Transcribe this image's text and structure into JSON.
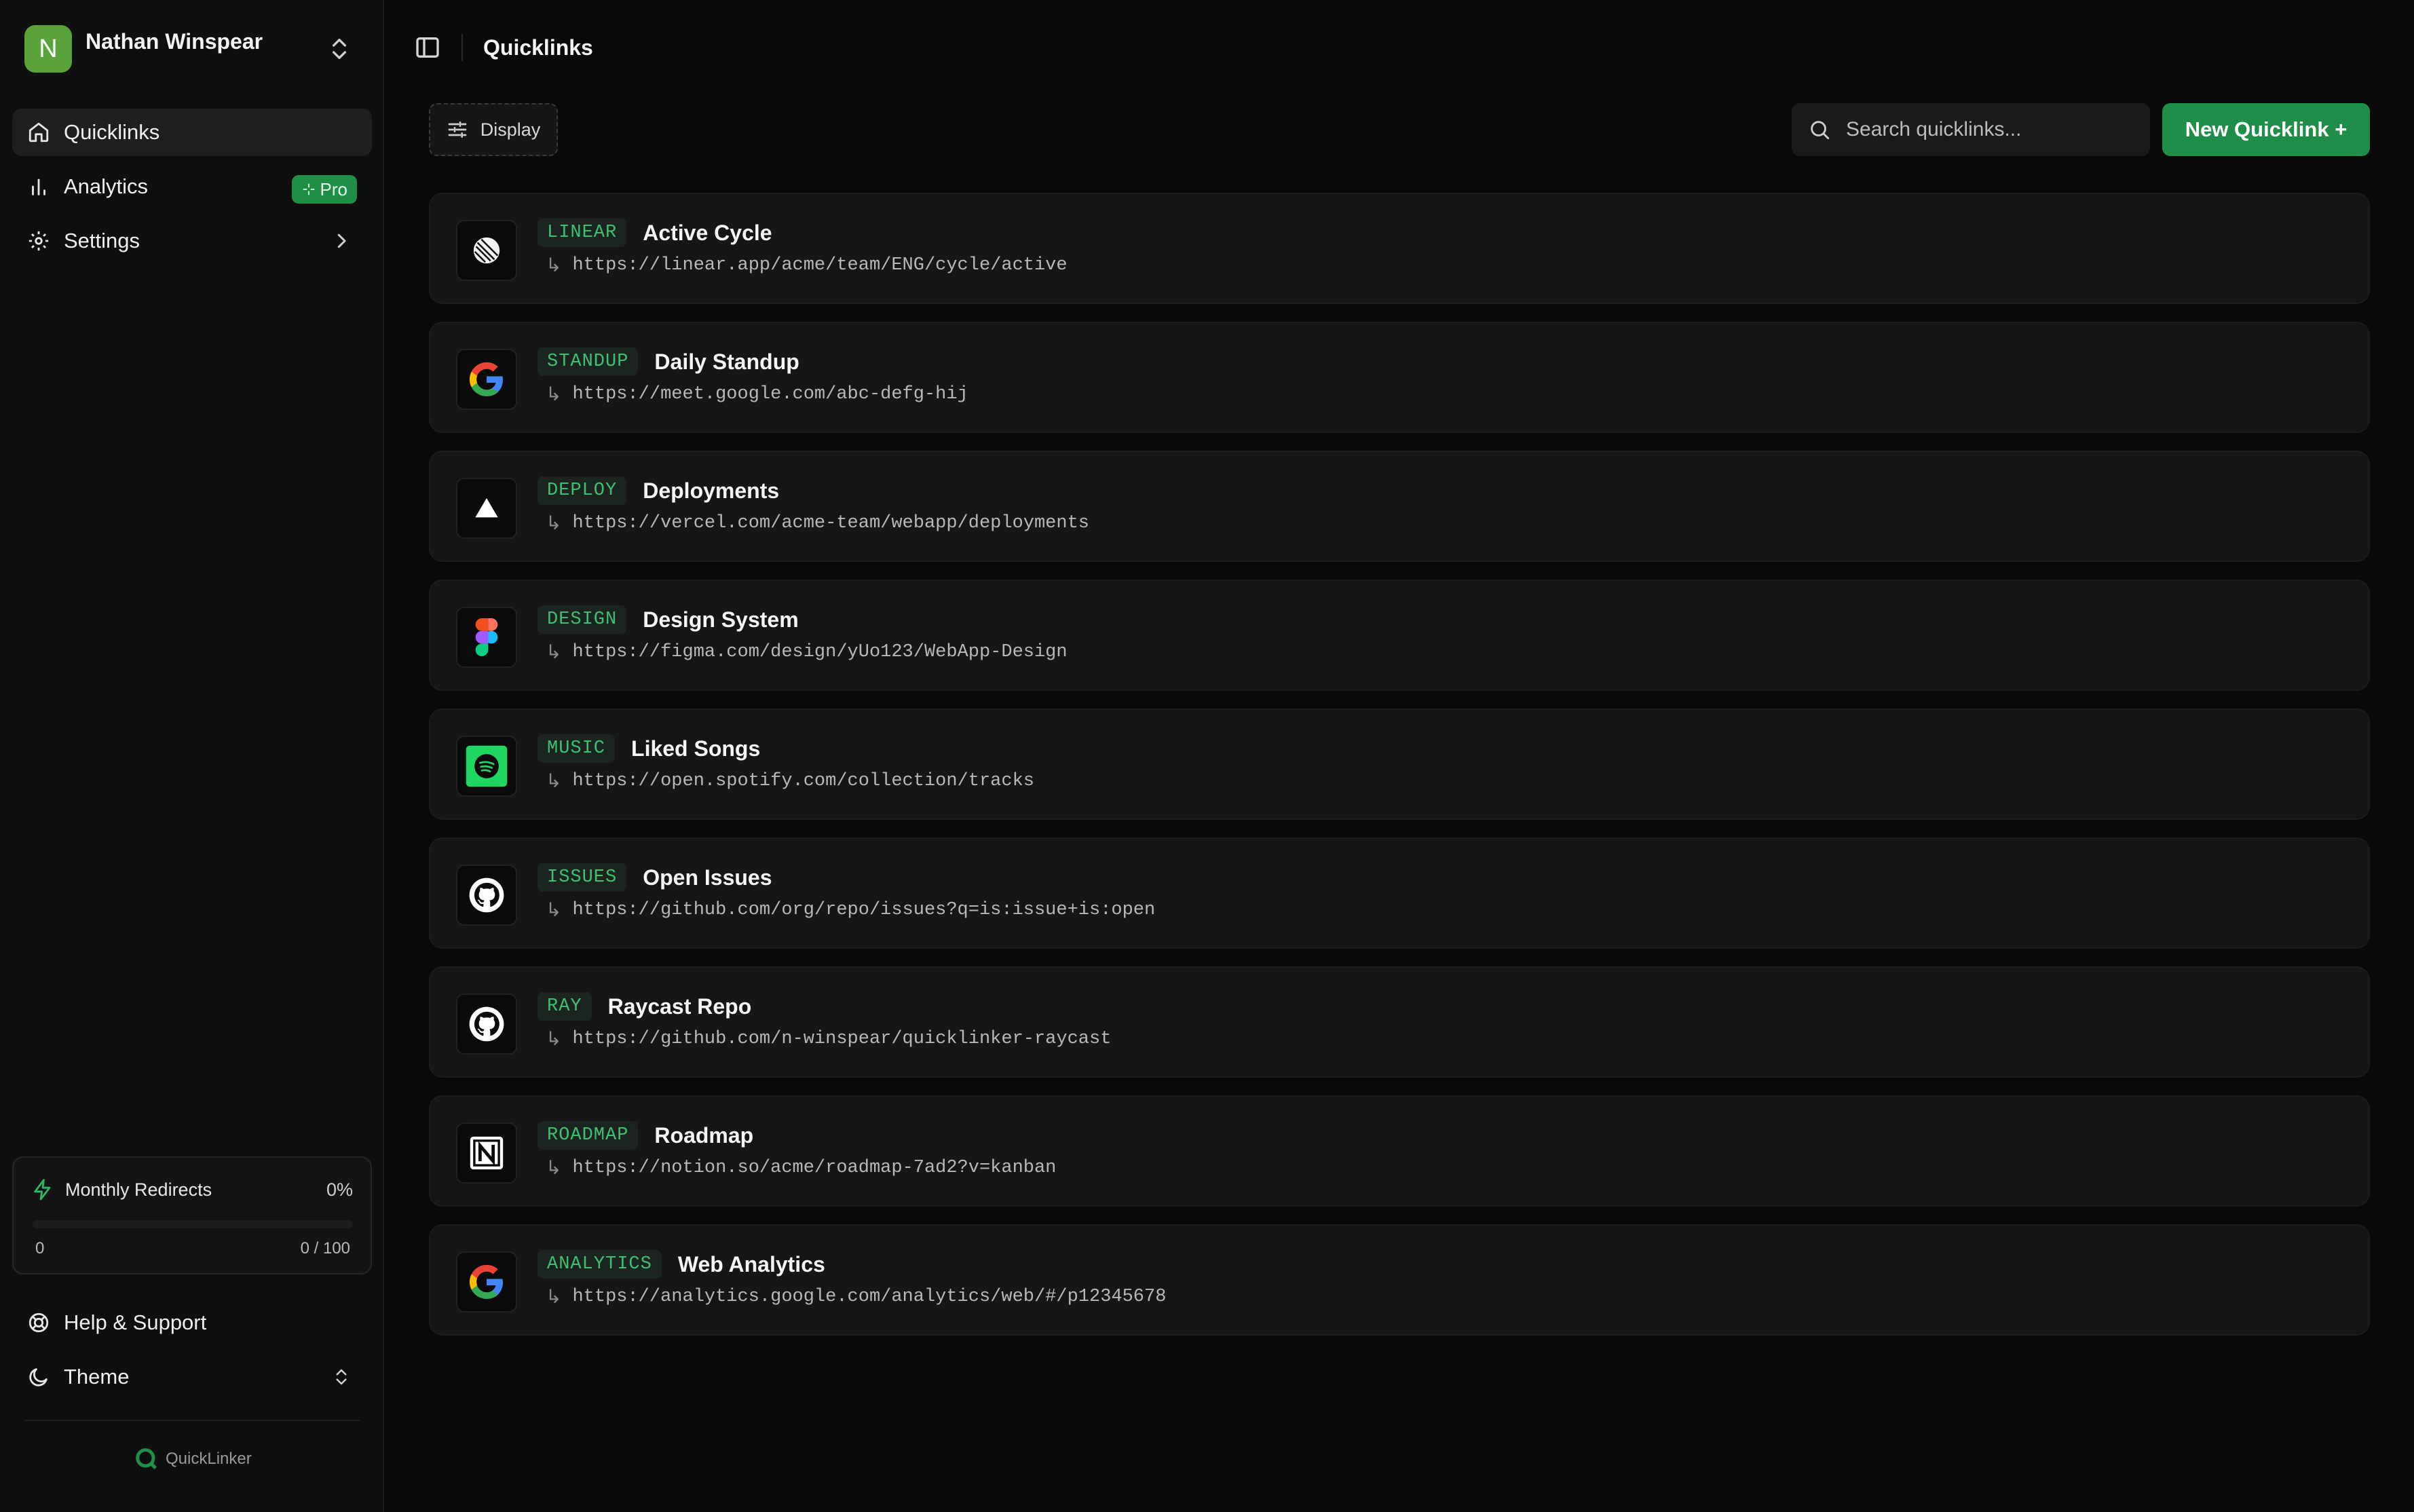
{
  "user": {
    "initial": "N",
    "name": "Nathan Winspear"
  },
  "nav": {
    "quicklinks": "Quicklinks",
    "analytics": "Analytics",
    "pro_badge": "Pro",
    "settings": "Settings"
  },
  "usage": {
    "title": "Monthly Redirects",
    "percent": "0%",
    "min": "0",
    "max": "0 / 100",
    "fill_fraction": 0
  },
  "bottom": {
    "help": "Help & Support",
    "theme": "Theme",
    "brand": "QuickLinker"
  },
  "header": {
    "title": "Quicklinks"
  },
  "toolbar": {
    "display_label": "Display",
    "search_placeholder": "Search quicklinks...",
    "new_label": "New Quicklink +"
  },
  "colors": {
    "accent": "#1f8e48",
    "tag_text": "#3ec072",
    "background": "#0a0a0a"
  },
  "quicklinks": [
    {
      "tag": "LINEAR",
      "title": "Active Cycle",
      "url": "https://linear.app/acme/team/ENG/cycle/active",
      "icon": "linear-icon"
    },
    {
      "tag": "STANDUP",
      "title": "Daily Standup",
      "url": "https://meet.google.com/abc-defg-hij",
      "icon": "google-icon"
    },
    {
      "tag": "DEPLOY",
      "title": "Deployments",
      "url": "https://vercel.com/acme-team/webapp/deployments",
      "icon": "vercel-icon"
    },
    {
      "tag": "DESIGN",
      "title": "Design System",
      "url": "https://figma.com/design/yUo123/WebApp-Design",
      "icon": "figma-icon"
    },
    {
      "tag": "MUSIC",
      "title": "Liked Songs",
      "url": "https://open.spotify.com/collection/tracks",
      "icon": "spotify-icon"
    },
    {
      "tag": "ISSUES",
      "title": "Open Issues",
      "url": "https://github.com/org/repo/issues?q=is:issue+is:open",
      "icon": "github-icon"
    },
    {
      "tag": "RAY",
      "title": "Raycast Repo",
      "url": "https://github.com/n-winspear/quicklinker-raycast",
      "icon": "github-icon"
    },
    {
      "tag": "ROADMAP",
      "title": "Roadmap",
      "url": "https://notion.so/acme/roadmap-7ad2?v=kanban",
      "icon": "notion-icon"
    },
    {
      "tag": "ANALYTICS",
      "title": "Web Analytics",
      "url": "https://analytics.google.com/analytics/web/#/p12345678",
      "icon": "google-icon"
    }
  ]
}
